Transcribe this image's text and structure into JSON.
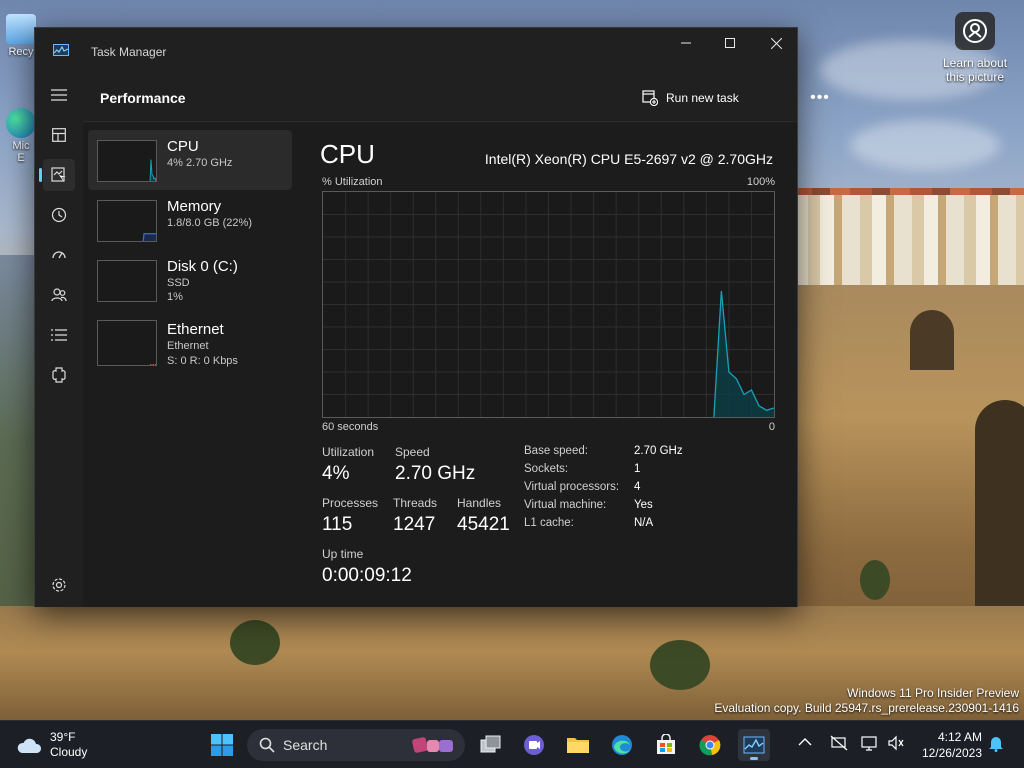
{
  "desktop": {
    "icon_recycle_label": "Recy",
    "icon_edge_label": "Mic\nE",
    "learn_label": "Learn about this picture",
    "watermark_line1": "Windows 11 Pro Insider Preview",
    "watermark_line2": "Evaluation copy. Build 25947.rs_prerelease.230901-1416"
  },
  "window": {
    "title": "Task Manager",
    "controls": {
      "minimize": "—",
      "maximize": "☐",
      "close": "✕"
    }
  },
  "nav": {
    "items": [
      "hamburger-icon",
      "processes-icon",
      "performance-icon",
      "app-history-icon",
      "startup-apps-icon",
      "users-icon",
      "details-icon",
      "services-icon",
      "settings-icon"
    ],
    "active": "performance-icon"
  },
  "header": {
    "page_title": "Performance",
    "run_new_task": "Run new task",
    "more": "•••"
  },
  "sidebar": {
    "items": [
      {
        "name": "CPU",
        "line1": "4% 2.70 GHz",
        "line2": ""
      },
      {
        "name": "Memory",
        "line1": "1.8/8.0 GB (22%)",
        "line2": ""
      },
      {
        "name": "Disk 0 (C:)",
        "line1": "SSD",
        "line2": "1%"
      },
      {
        "name": "Ethernet",
        "line1": "Ethernet",
        "line2": "S: 0 R: 0 Kbps"
      }
    ],
    "selected": "CPU",
    "memory_usage_fraction": 0.22
  },
  "detail": {
    "title": "CPU",
    "model": "Intel(R) Xeon(R) CPU E5-2697 v2 @ 2.70GHz",
    "y_label": "% Utilization",
    "y_max_label": "100%",
    "x_left_label": "60 seconds",
    "x_right_label": "0",
    "stats": {
      "utilization_label": "Utilization",
      "utilization": "4%",
      "speed_label": "Speed",
      "speed": "2.70 GHz",
      "processes_label": "Processes",
      "processes": "115",
      "threads_label": "Threads",
      "threads": "1247",
      "handles_label": "Handles",
      "handles": "45421",
      "uptime_label": "Up time",
      "uptime": "0:00:09:12"
    },
    "info": [
      {
        "k": "Base speed:",
        "v": "2.70 GHz"
      },
      {
        "k": "Sockets:",
        "v": "1"
      },
      {
        "k": "Virtual processors:",
        "v": "4"
      },
      {
        "k": "Virtual machine:",
        "v": "Yes"
      },
      {
        "k": "L1 cache:",
        "v": "N/A"
      }
    ]
  },
  "chart_data": {
    "type": "area",
    "x_range": [
      60,
      0
    ],
    "ylim": [
      0,
      100
    ],
    "ylabel": "% Utilization",
    "grid": true,
    "x": [
      60,
      49,
      48,
      47,
      46,
      45,
      44,
      43,
      42,
      41,
      40,
      39,
      38,
      37,
      36,
      35,
      34,
      33,
      32,
      31,
      30,
      29,
      28,
      27,
      26,
      25,
      24,
      23,
      22,
      21,
      20,
      19,
      18,
      17,
      16,
      15,
      14,
      13,
      12,
      11,
      10,
      9,
      8,
      7,
      6,
      5,
      4,
      3,
      2,
      1,
      0
    ],
    "values": [
      0,
      0,
      0,
      0,
      0,
      0,
      0,
      0,
      0,
      0,
      0,
      0,
      0,
      0,
      0,
      0,
      0,
      0,
      0,
      0,
      0,
      0,
      0,
      0,
      0,
      0,
      0,
      0,
      0,
      0,
      0,
      0,
      0,
      0,
      0,
      0,
      0,
      0,
      0,
      0,
      0,
      0,
      0,
      56,
      20,
      17,
      10,
      12,
      5,
      3,
      4
    ]
  },
  "taskbar": {
    "weather_temp": "39°F",
    "weather_desc": "Cloudy",
    "search_placeholder": "Search",
    "apps": [
      "start-icon",
      "task-view-icon",
      "teams-icon",
      "file-explorer-icon",
      "edge-icon",
      "store-icon",
      "chrome-icon",
      "task-manager-icon"
    ],
    "active_app": "task-manager-icon",
    "time": "4:12 AM",
    "date": "12/26/2023"
  },
  "colors": {
    "accent": "#60cdff",
    "graph_line": "#17a2b8",
    "graph_fill": "#0d3c44",
    "memory_line": "#3a6fd0",
    "ethernet_mark": "#c94a4a"
  }
}
